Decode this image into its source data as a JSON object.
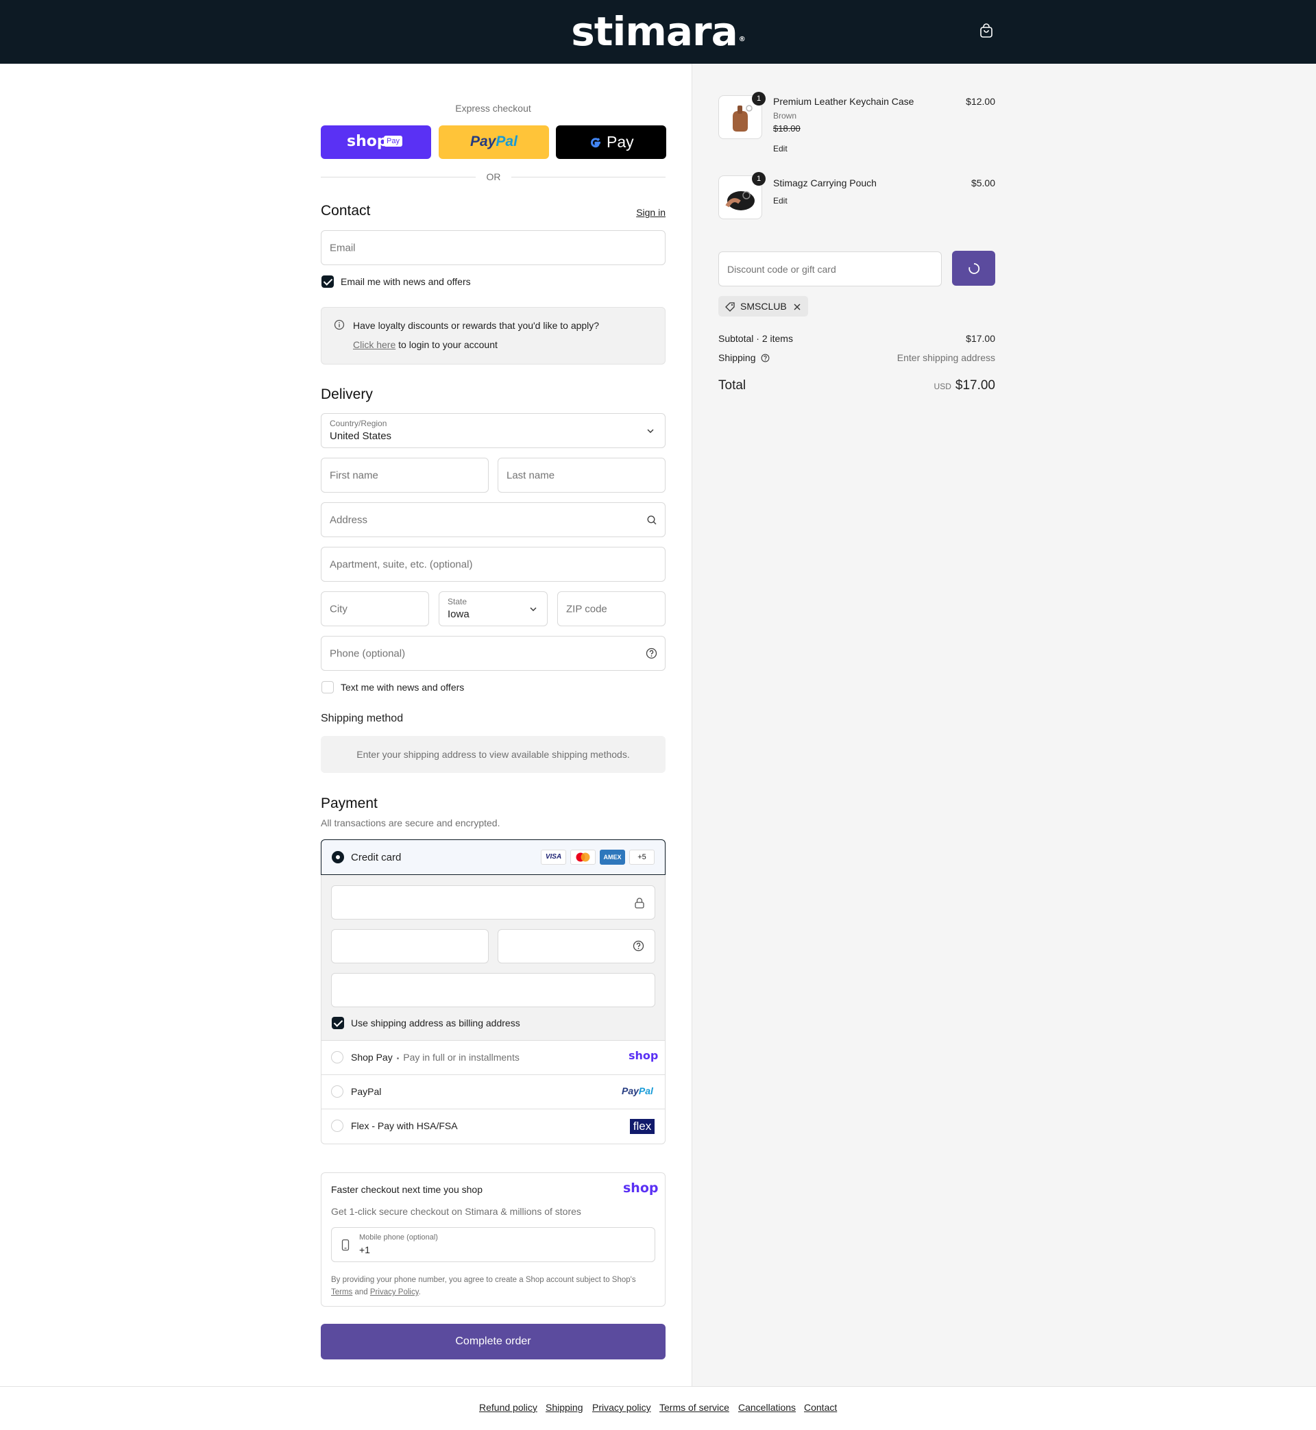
{
  "header": {
    "brand": "stimara",
    "trademark": "®"
  },
  "express": {
    "title": "Express checkout",
    "shop_pay": "shop",
    "shop_pay_sub": "Pay",
    "paypal_pay": "Pay",
    "paypal_pal": "Pal",
    "gpay": "Pay",
    "separator": "OR"
  },
  "contact": {
    "title": "Contact",
    "sign_in": "Sign in",
    "email_placeholder": "Email",
    "news_label": "Email me with news and offers",
    "loyalty_text": "Have loyalty discounts or rewards that you'd like to apply?",
    "loyalty_link": "Click here",
    "loyalty_suffix": " to login to your account"
  },
  "delivery": {
    "title": "Delivery",
    "country_label": "Country/Region",
    "country_value": "United States",
    "first_name": "First name",
    "last_name": "Last name",
    "address": "Address",
    "apartment": "Apartment, suite, etc. (optional)",
    "city": "City",
    "state_label": "State",
    "state_value": "Iowa",
    "zip": "ZIP code",
    "phone": "Phone (optional)",
    "text_label": "Text me with news and offers",
    "shipping_method_title": "Shipping method",
    "shipping_method_note": "Enter your shipping address to view available shipping methods."
  },
  "payment": {
    "title": "Payment",
    "subtitle": "All transactions are secure and encrypted.",
    "credit_card": "Credit card",
    "visa": "VISA",
    "amex": "AMEX",
    "more_cards": "+5",
    "billing_label": "Use shipping address as billing address",
    "shop_pay_label": "Shop Pay",
    "shop_pay_dot": "•",
    "shop_pay_note": "Pay in full or in installments",
    "shop_logo": "shop",
    "paypal_label": "PayPal",
    "paypal_logo_pay": "Pay",
    "paypal_logo_pal": "Pal",
    "flex_label": "Flex - Pay with HSA/FSA",
    "flex_logo": "flex"
  },
  "shop_promo": {
    "title": "Faster checkout next time you shop",
    "logo": "shop",
    "subtitle": "Get 1-click secure checkout on Stimara & millions of stores",
    "phone_label": "Mobile phone (optional)",
    "phone_value": "+1",
    "legal_prefix": "By providing your phone number, you agree to create a Shop account subject to Shop's",
    "terms": "Terms",
    "and": " and ",
    "privacy": "Privacy Policy",
    "period": "."
  },
  "complete_order": "Complete order",
  "summary": {
    "items": [
      {
        "qty": "1",
        "name": "Premium Leather Keychain Case",
        "variant": "Brown",
        "old_price": "$18.00",
        "price": "$12.00",
        "edit": "Edit"
      },
      {
        "qty": "1",
        "name": "Stimagz Carrying Pouch",
        "price": "$5.00",
        "edit": "Edit"
      }
    ],
    "discount_placeholder": "Discount code or gift card",
    "applied_code": "SMSCLUB",
    "subtotal_label": "Subtotal · 2 items",
    "subtotal_value": "$17.00",
    "shipping_label": "Shipping",
    "shipping_value": "Enter shipping address",
    "total_label": "Total",
    "currency": "USD",
    "total_value": "$17.00"
  },
  "footer": {
    "links": [
      "Refund policy",
      "Shipping",
      "Privacy policy",
      "Terms of service",
      "Cancellations",
      "Contact"
    ]
  },
  "colors": {
    "header_bg": "#0d1a24",
    "shop_purple": "#5a31f4",
    "paypal_yellow": "#ffc439",
    "button_purple": "#5b4b9e"
  }
}
